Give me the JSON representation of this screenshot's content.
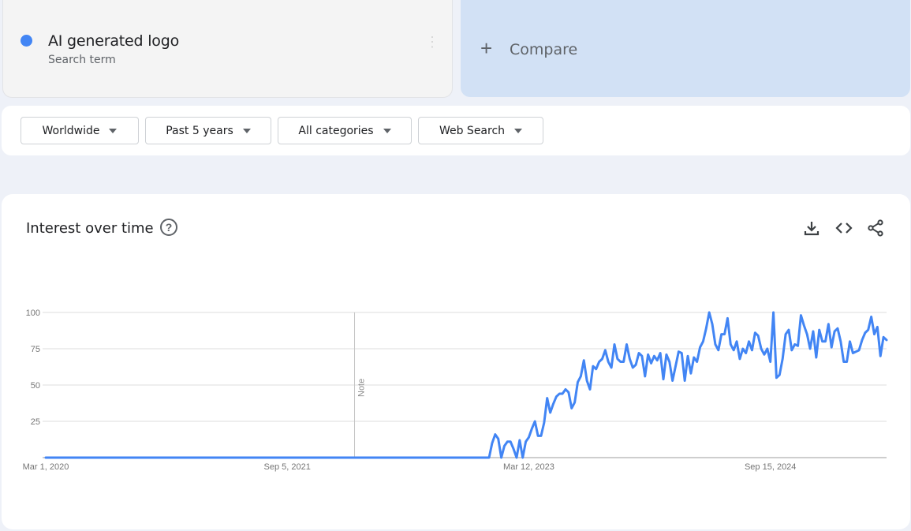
{
  "search_term": {
    "name": "AI generated logo",
    "subtitle": "Search term",
    "color": "#4285f4"
  },
  "compare": {
    "label": "Compare"
  },
  "filters": [
    {
      "label": "Worldwide"
    },
    {
      "label": "Past 5 years"
    },
    {
      "label": "All categories"
    },
    {
      "label": "Web Search"
    }
  ],
  "interest_panel": {
    "title": "Interest over time",
    "icons": [
      "help-icon",
      "download-icon",
      "embed-code-icon",
      "share-icon"
    ]
  },
  "chart_data": {
    "type": "line",
    "series": [
      {
        "color": "#4285f4",
        "values": [
          0,
          0,
          0,
          0,
          0,
          0,
          0,
          0,
          0,
          0,
          0,
          0,
          0,
          0,
          0,
          0,
          0,
          0,
          0,
          0,
          0,
          0,
          0,
          0,
          0,
          0,
          0,
          0,
          0,
          0,
          0,
          0,
          0,
          0,
          0,
          0,
          0,
          0,
          0,
          0,
          0,
          0,
          0,
          0,
          0,
          0,
          0,
          0,
          0,
          0,
          0,
          0,
          0,
          0,
          0,
          0,
          0,
          0,
          0,
          0,
          0,
          0,
          0,
          0,
          0,
          0,
          0,
          0,
          0,
          0,
          0,
          0,
          0,
          0,
          0,
          0,
          0,
          0,
          0,
          0,
          0,
          0,
          0,
          0,
          0,
          0,
          0,
          0,
          0,
          0,
          0,
          0,
          0,
          0,
          0,
          0,
          0,
          0,
          0,
          0,
          0,
          0,
          0,
          0,
          0,
          0,
          0,
          0,
          0,
          0,
          0,
          0,
          0,
          0,
          0,
          0,
          0,
          0,
          0,
          0,
          0,
          0,
          0,
          0,
          0,
          0,
          0,
          0,
          0,
          0,
          0,
          0,
          0,
          0,
          0,
          0,
          0,
          0,
          0,
          0,
          0,
          0,
          0,
          0,
          0,
          0,
          10,
          16,
          13,
          0,
          8,
          11,
          11,
          6,
          0,
          12,
          0,
          11,
          14,
          20,
          25,
          15,
          15,
          24,
          41,
          31,
          37,
          42,
          44,
          44,
          47,
          45,
          34,
          38,
          52,
          56,
          67,
          53,
          47,
          63,
          61,
          66,
          68,
          74,
          66,
          62,
          78,
          68,
          66,
          66,
          78,
          68,
          62,
          64,
          72,
          70,
          56,
          71,
          65,
          70,
          67,
          72,
          54,
          71,
          66,
          53,
          63,
          73,
          72,
          53,
          70,
          58,
          69,
          66,
          76,
          80,
          89,
          100,
          92,
          78,
          74,
          85,
          85,
          96,
          78,
          74,
          80,
          68,
          75,
          72,
          80,
          74,
          86,
          84,
          75,
          71,
          75,
          66,
          100,
          55,
          57,
          68,
          85,
          88,
          74,
          78,
          77,
          98,
          91,
          85,
          75,
          87,
          69,
          88,
          80,
          80,
          92,
          76,
          87,
          89,
          80,
          66,
          66,
          80,
          72,
          73,
          74,
          81,
          86,
          88,
          97,
          85,
          90,
          70,
          83,
          81
        ]
      }
    ],
    "x_tick_labels": [
      "Mar 1, 2020",
      "Sep 5, 2021",
      "Mar 12, 2023",
      "Sep 15, 2024"
    ],
    "y_ticks": [
      25,
      50,
      75,
      100
    ],
    "ylim": [
      0,
      100
    ],
    "annotation": {
      "text": "Note",
      "week_index": 101
    },
    "grid": true
  }
}
